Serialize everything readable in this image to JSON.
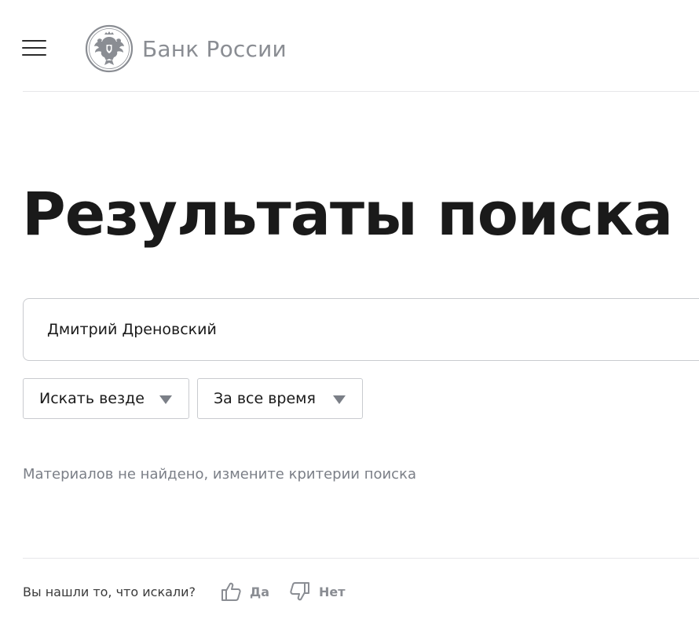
{
  "header": {
    "logo_text": "Банк России",
    "menu_icon": "hamburger-icon",
    "emblem_icon": "double-headed-eagle-icon"
  },
  "main": {
    "title": "Результаты поиска",
    "search": {
      "value": "Дмитрий Дреновский"
    },
    "filters": {
      "scope": {
        "selected": "Искать везде"
      },
      "period": {
        "selected": "За все время"
      }
    },
    "empty_message": "Материалов не найдено, измените критерии поиска"
  },
  "feedback": {
    "question": "Вы нашли то, что искали?",
    "yes_label": "Да",
    "no_label": "Нет",
    "yes_icon": "thumbs-up-icon",
    "no_icon": "thumbs-down-icon"
  },
  "colors": {
    "text": "#1a1a1a",
    "muted": "#8a8d93",
    "border": "#c9cbcf",
    "divider": "#e6e7e9"
  }
}
